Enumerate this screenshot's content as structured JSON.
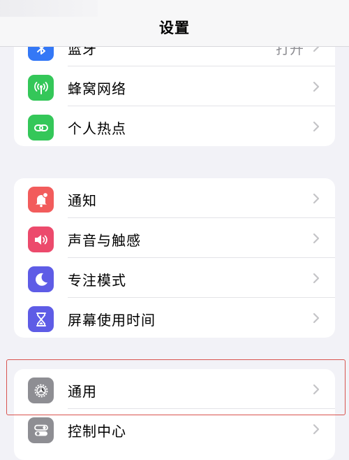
{
  "header": {
    "title": "设置"
  },
  "groups": [
    {
      "rows": [
        {
          "label": "蓝牙",
          "value": "打开",
          "icon": "bluetooth-icon",
          "color": "#3478f6"
        },
        {
          "label": "蜂窝网络",
          "icon": "cellular-antenna-icon",
          "color": "#34c759"
        },
        {
          "label": "个人热点",
          "icon": "hotspot-chain-icon",
          "color": "#34c759"
        }
      ]
    },
    {
      "rows": [
        {
          "label": "通知",
          "icon": "bell-icon",
          "color": "#f25c5c"
        },
        {
          "label": "声音与触感",
          "icon": "speaker-icon",
          "color": "#ec4a6c"
        },
        {
          "label": "专注模式",
          "icon": "moon-icon",
          "color": "#5e5ce6"
        },
        {
          "label": "屏幕使用时间",
          "icon": "hourglass-icon",
          "color": "#5e5ce6"
        }
      ]
    },
    {
      "rows": [
        {
          "label": "通用",
          "icon": "gear-icon",
          "color": "#8e8e93"
        },
        {
          "label": "控制中心",
          "icon": "toggles-icon",
          "color": "#8e8e93"
        }
      ]
    }
  ],
  "highlight": {
    "color": "#d9534f",
    "target": "通用"
  }
}
